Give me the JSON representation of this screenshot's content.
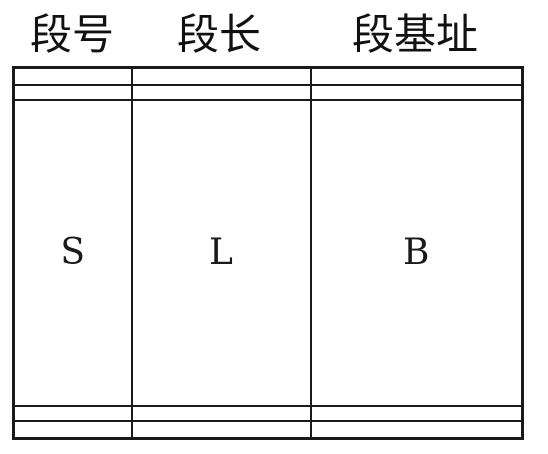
{
  "table": {
    "headers": [
      "段号",
      "段长",
      "段基址"
    ],
    "rows": [
      [
        "",
        "",
        ""
      ],
      [
        "",
        "",
        ""
      ],
      [
        "S",
        "L",
        "B"
      ],
      [
        "",
        "",
        ""
      ],
      [
        "",
        "",
        ""
      ]
    ]
  }
}
